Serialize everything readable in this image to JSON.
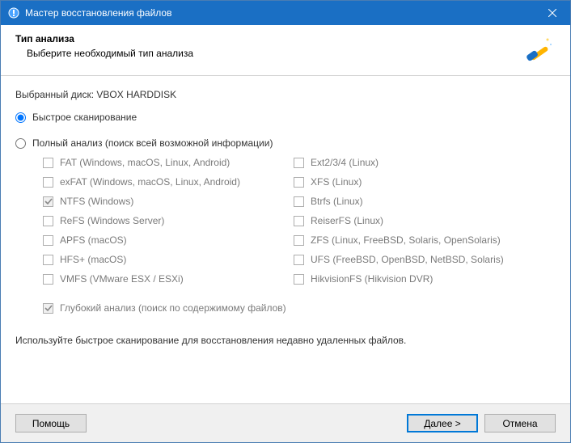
{
  "window": {
    "title": "Мастер восстановления файлов"
  },
  "header": {
    "title": "Тип анализа",
    "subtitle": "Выберите необходимый тип анализа"
  },
  "content": {
    "disk_label": "Выбранный диск: VBOX HARDDISK",
    "scan": {
      "quick_label": "Быстрое сканирование",
      "full_label": "Полный анализ (поиск всей возможной информации)",
      "selected": "quick"
    },
    "filesystems_left": [
      {
        "label": "FAT (Windows, macOS, Linux, Android)",
        "checked": false
      },
      {
        "label": "exFAT (Windows, macOS, Linux, Android)",
        "checked": false
      },
      {
        "label": "NTFS (Windows)",
        "checked": true
      },
      {
        "label": "ReFS (Windows Server)",
        "checked": false
      },
      {
        "label": "APFS (macOS)",
        "checked": false
      },
      {
        "label": "HFS+ (macOS)",
        "checked": false
      },
      {
        "label": "VMFS (VMware ESX / ESXi)",
        "checked": false
      }
    ],
    "filesystems_right": [
      {
        "label": "Ext2/3/4 (Linux)",
        "checked": false
      },
      {
        "label": "XFS (Linux)",
        "checked": false
      },
      {
        "label": "Btrfs (Linux)",
        "checked": false
      },
      {
        "label": "ReiserFS (Linux)",
        "checked": false
      },
      {
        "label": "ZFS (Linux, FreeBSD, Solaris, OpenSolaris)",
        "checked": false
      },
      {
        "label": "UFS (FreeBSD, OpenBSD, NetBSD, Solaris)",
        "checked": false
      },
      {
        "label": "HikvisionFS (Hikvision DVR)",
        "checked": false
      }
    ],
    "deep_analysis": {
      "label": "Глубокий анализ (поиск по содержимому файлов)",
      "checked": true
    },
    "hint": "Используйте быстрое сканирование для восстановления недавно удаленных файлов."
  },
  "footer": {
    "help": "Помощь",
    "next": "Далее >",
    "cancel": "Отмена"
  }
}
